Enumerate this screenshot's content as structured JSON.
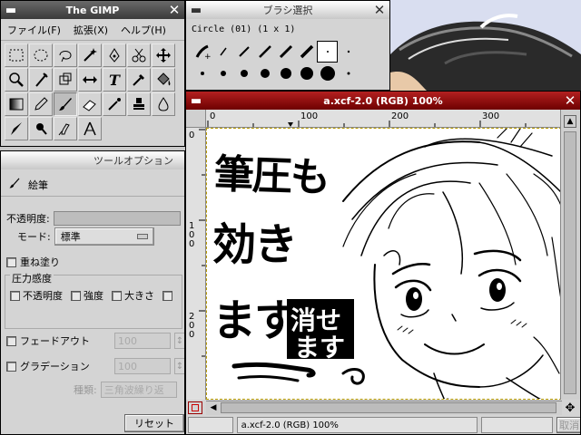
{
  "toolbox": {
    "title": "The GIMP",
    "menus": [
      "ファイル(F)",
      "拡張(X)",
      "ヘルプ(H)"
    ],
    "tools": [
      {
        "name": "rect-select-icon"
      },
      {
        "name": "ellipse-select-icon"
      },
      {
        "name": "lasso-icon"
      },
      {
        "name": "magic-wand-icon"
      },
      {
        "name": "bezier-select-icon"
      },
      {
        "name": "scissors-icon"
      },
      {
        "name": "move-icon"
      },
      {
        "name": "magnify-icon"
      },
      {
        "name": "crop-icon"
      },
      {
        "name": "transform-icon"
      },
      {
        "name": "flip-icon"
      },
      {
        "name": "text-tool-icon"
      },
      {
        "name": "color-picker-icon"
      },
      {
        "name": "bucket-fill-icon"
      },
      {
        "name": "gradient-icon"
      },
      {
        "name": "pencil-icon"
      },
      {
        "name": "paintbrush-icon"
      },
      {
        "name": "eraser-icon"
      },
      {
        "name": "airbrush-icon"
      },
      {
        "name": "clone-stamp-icon"
      },
      {
        "name": "blur-icon"
      },
      {
        "name": "ink-icon"
      },
      {
        "name": "dodge-burn-icon"
      },
      {
        "name": "smudge-icon"
      },
      {
        "name": "measure-icon"
      }
    ],
    "active_tool_index": 16
  },
  "tool_options": {
    "title": "ツールオプション",
    "tool_name": "絵筆",
    "opacity_label": "不透明度:",
    "mode_label": "モード:",
    "mode_value": "標準",
    "incremental_label": "重ね塗り",
    "pressure_label": "圧力感度",
    "pressure_opacity": "不透明度",
    "pressure_strength": "強度",
    "pressure_size": "大きさ",
    "fade_label": "フェードアウト",
    "fade_value": "100",
    "gradient_label": "グラデーション",
    "gradient_value": "100",
    "type_label": "種類:",
    "type_value": "三角波繰り返",
    "reset_label": "リセット"
  },
  "brushes": {
    "title": "ブラシ選択",
    "brush_info": "Circle (01)  (1 x 1)"
  },
  "image_window": {
    "title": "a.xcf-2.0 (RGB) 100%",
    "ruler_top": [
      "0",
      "100",
      "200",
      "300"
    ],
    "ruler_left": [
      "0",
      "1\n0\n0",
      "2\n0\n0"
    ],
    "status_text": "a.xcf-2.0 (RGB) 100%",
    "cancel_label": "取消",
    "canvas_text": {
      "line1": "筆圧も",
      "line2": "効き",
      "line3": "ます",
      "stamp_top": "消せ",
      "stamp_bottom": "ます"
    }
  }
}
